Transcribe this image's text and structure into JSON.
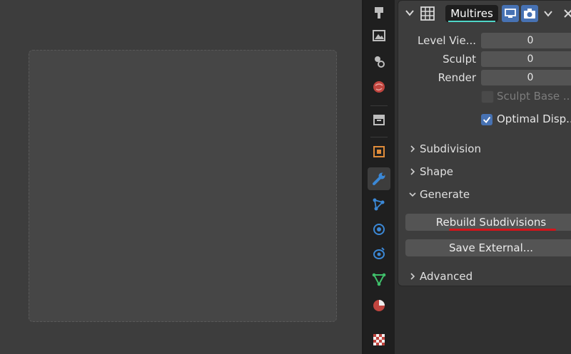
{
  "modifier": {
    "name": "Multires",
    "levels": [
      {
        "label": "Level Vie...",
        "value": "0"
      },
      {
        "label": "Sculpt",
        "value": "0"
      },
      {
        "label": "Render",
        "value": "0"
      }
    ],
    "sculpt_base_mesh": {
      "label": "Sculpt Base ...",
      "checked": false
    },
    "optimal_display": {
      "label": "Optimal Disp...",
      "checked": true
    },
    "sections": {
      "subdivision": "Subdivision",
      "shape": "Shape",
      "generate": "Generate",
      "advanced": "Advanced"
    },
    "buttons": {
      "rebuild": "Rebuild Subdivisions",
      "save_external": "Save External..."
    }
  },
  "tabs": [
    "tool-icon",
    "render-icon",
    "output-icon",
    "view-layer-icon",
    "scene-icon",
    "world-icon",
    "collection-icon",
    "object-icon",
    "modifier-icon",
    "particles-icon",
    "physics-icon",
    "constraints-icon",
    "data-icon",
    "material-icon",
    "texture-icon"
  ],
  "colors": {
    "accent_blue": "#4772b3",
    "active_modifier_tab": "#3b88d6",
    "name_underline": "#4fd6c8",
    "highlight_underline": "#d4141a"
  }
}
